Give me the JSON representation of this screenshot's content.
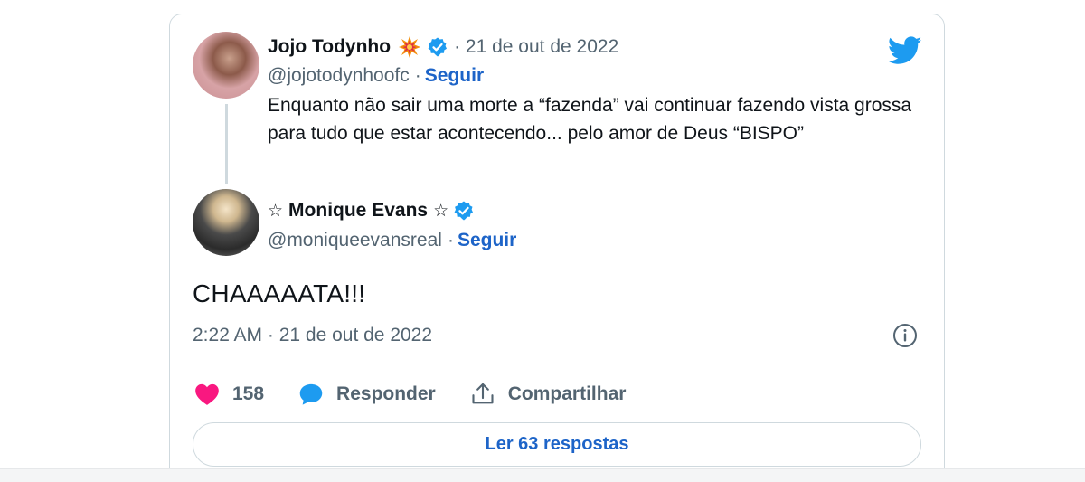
{
  "quoted_tweet": {
    "author_name": "Jojo Todynho",
    "author_emoji": "collision-emoji-icon",
    "verified": true,
    "date": "· 21 de out de 2022",
    "handle": "@jojotodynhoofc",
    "separator": "·",
    "follow_label": "Seguir",
    "text": "Enquanto não  sair uma morte a “fazenda” vai continuar fazendo vista grossa para tudo que estar acontecendo... pelo amor de Deus “BISPO”"
  },
  "tweet": {
    "author_name_prefix": "☆",
    "author_name": "Monique Evans",
    "author_name_suffix": "☆",
    "verified": true,
    "handle": "@moniqueevansreal",
    "separator": "·",
    "follow_label": "Seguir",
    "text": "CHAAAAATA!!!",
    "timestamp": "2:22 AM · 21 de out de 2022"
  },
  "actions": {
    "like_count": "158",
    "reply_label": "Responder",
    "share_label": "Compartilhar"
  },
  "replies_button_label": "Ler 63 respostas",
  "colors": {
    "twitter_blue": "#1d9bf0",
    "link_blue": "#1d64c8",
    "like_pink": "#f91880",
    "secondary_text": "#536471",
    "border": "#cfd9de"
  },
  "icons": {
    "brand": "twitter-bird-icon",
    "info": "info-icon",
    "like": "heart-icon",
    "reply": "speech-bubble-icon",
    "share": "share-upload-icon",
    "verified": "verified-badge-icon"
  }
}
